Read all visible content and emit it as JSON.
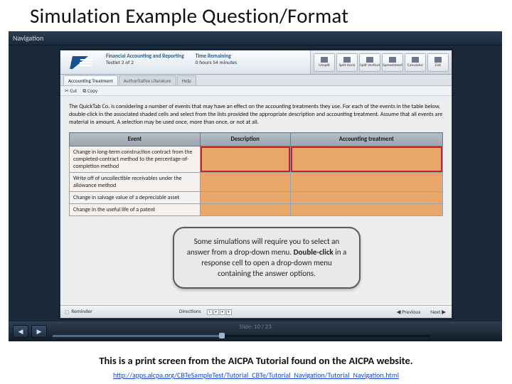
{
  "title": "Simulation Example Question/Format",
  "nav_label": "Navigation",
  "header": {
    "section_label": "Financial Accounting and Reporting",
    "testlet": "Testlet 2 of 2",
    "time_label": "Time Remaining",
    "time_value": "0 hours 54 minutes",
    "tools": [
      "Unsplit",
      "Split Horiz",
      "Split Vertical",
      "Spreadsheet",
      "Calculator",
      "Exit"
    ]
  },
  "tabs": {
    "active": "Accounting Treatment",
    "others": [
      "Authoritative Literature",
      "Help"
    ]
  },
  "editbar": {
    "cut": "Cut",
    "copy": "Copy"
  },
  "instructions": "The QuickTab Co. is considering a number of events that may have an effect on the accounting treatments they use. For each of the events in the table below, double-click in the associated shaded cells and select from the lists provided the appropriate description and accounting treatment. Assume that all events are material in amount. A selection may be used once, more than once, or not at all.",
  "table": {
    "headers": [
      "Event",
      "Description",
      "Accounting treatment"
    ],
    "rows": [
      "Change in long-term construction contract from the completed-contract method to the percentage-of-completion method",
      "Write off of uncollectible receivables under the allowance method",
      "Change in salvage value of a depreciable asset",
      "Change in the useful life of a patent"
    ],
    "selected_row_index": 0
  },
  "callout": {
    "pre": "Some simulations will require you to select an answer from a drop-down menu. ",
    "bold": "Double-click",
    "post": " in a response cell to open a drop-down menu containing the answer options."
  },
  "footer": {
    "reminder": "Reminder",
    "directions": "Directions",
    "pager": [
      "1",
      "▾",
      "▾",
      "▾"
    ],
    "prev": "Previous",
    "next": "Next"
  },
  "slide_indicator": "Slide: 10 / 23",
  "caption": "This is a print screen from the AICPA Tutorial found on the AICPA website.",
  "link_text": "http://apps.aicpa.org/CBTeSampleTest/Tutorial_CBTe/Tutorial_Navigation/Tutorial_Navigation.html"
}
